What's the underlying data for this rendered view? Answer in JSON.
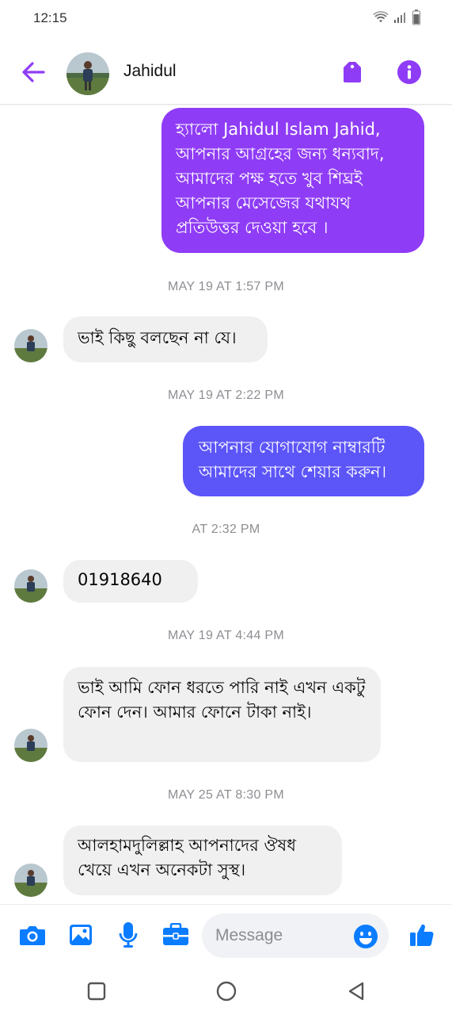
{
  "status_bar": {
    "time": "12:15"
  },
  "header": {
    "contact_name": "Jahidul"
  },
  "colors": {
    "accent": "#8f3cf6",
    "bubble_out_alt": "#5c55f8",
    "icon_blue": "#0a7cff"
  },
  "messages": [
    {
      "direction": "out",
      "text": "হ্যালো Jahidul Islam Jahid, আপনার আগ্রহের জন্য ধন্যবাদ, আমাদের পক্ষ হতে খুব শিঘ্রই আপনার মেসেজের যথাযথ প্রতিউত্তর দেওয়া হবে ।"
    },
    {
      "direction": "timestamp",
      "text": "MAY 19 AT 1:57 PM"
    },
    {
      "direction": "in",
      "text": "ভাই কিছু বলছেন না যে।"
    },
    {
      "direction": "timestamp",
      "text": "MAY 19 AT 2:22 PM"
    },
    {
      "direction": "out",
      "text": "আপনার যোগাযোগ নাম্বারটি আমাদের সাথে শেয়ার করুন।"
    },
    {
      "direction": "timestamp",
      "text": "AT 2:32 PM"
    },
    {
      "direction": "in",
      "text": "01918640"
    },
    {
      "direction": "timestamp",
      "text": "MAY 19 AT 4:44 PM"
    },
    {
      "direction": "in",
      "text": "ভাই আমি ফোন ধরতে পারি নাই  এখন একটু ফোন দেন। আমার ফোনে টাকা নাই।"
    },
    {
      "direction": "timestamp",
      "text": "MAY 25 AT 8:30 PM"
    },
    {
      "direction": "in",
      "text": "আলহামদুলিল্লাহ আপনাদের ঔষধ খেয়ে এখন অনেকটা সুস্থ।"
    }
  ],
  "composer": {
    "placeholder": "Message",
    "icons": [
      "camera-icon",
      "gallery-icon",
      "microphone-icon",
      "briefcase-icon",
      "emoji-icon",
      "thumbs-up-icon"
    ]
  },
  "nav_bar": {
    "icons": [
      "recents-icon",
      "home-icon",
      "back-triangle-icon"
    ]
  }
}
